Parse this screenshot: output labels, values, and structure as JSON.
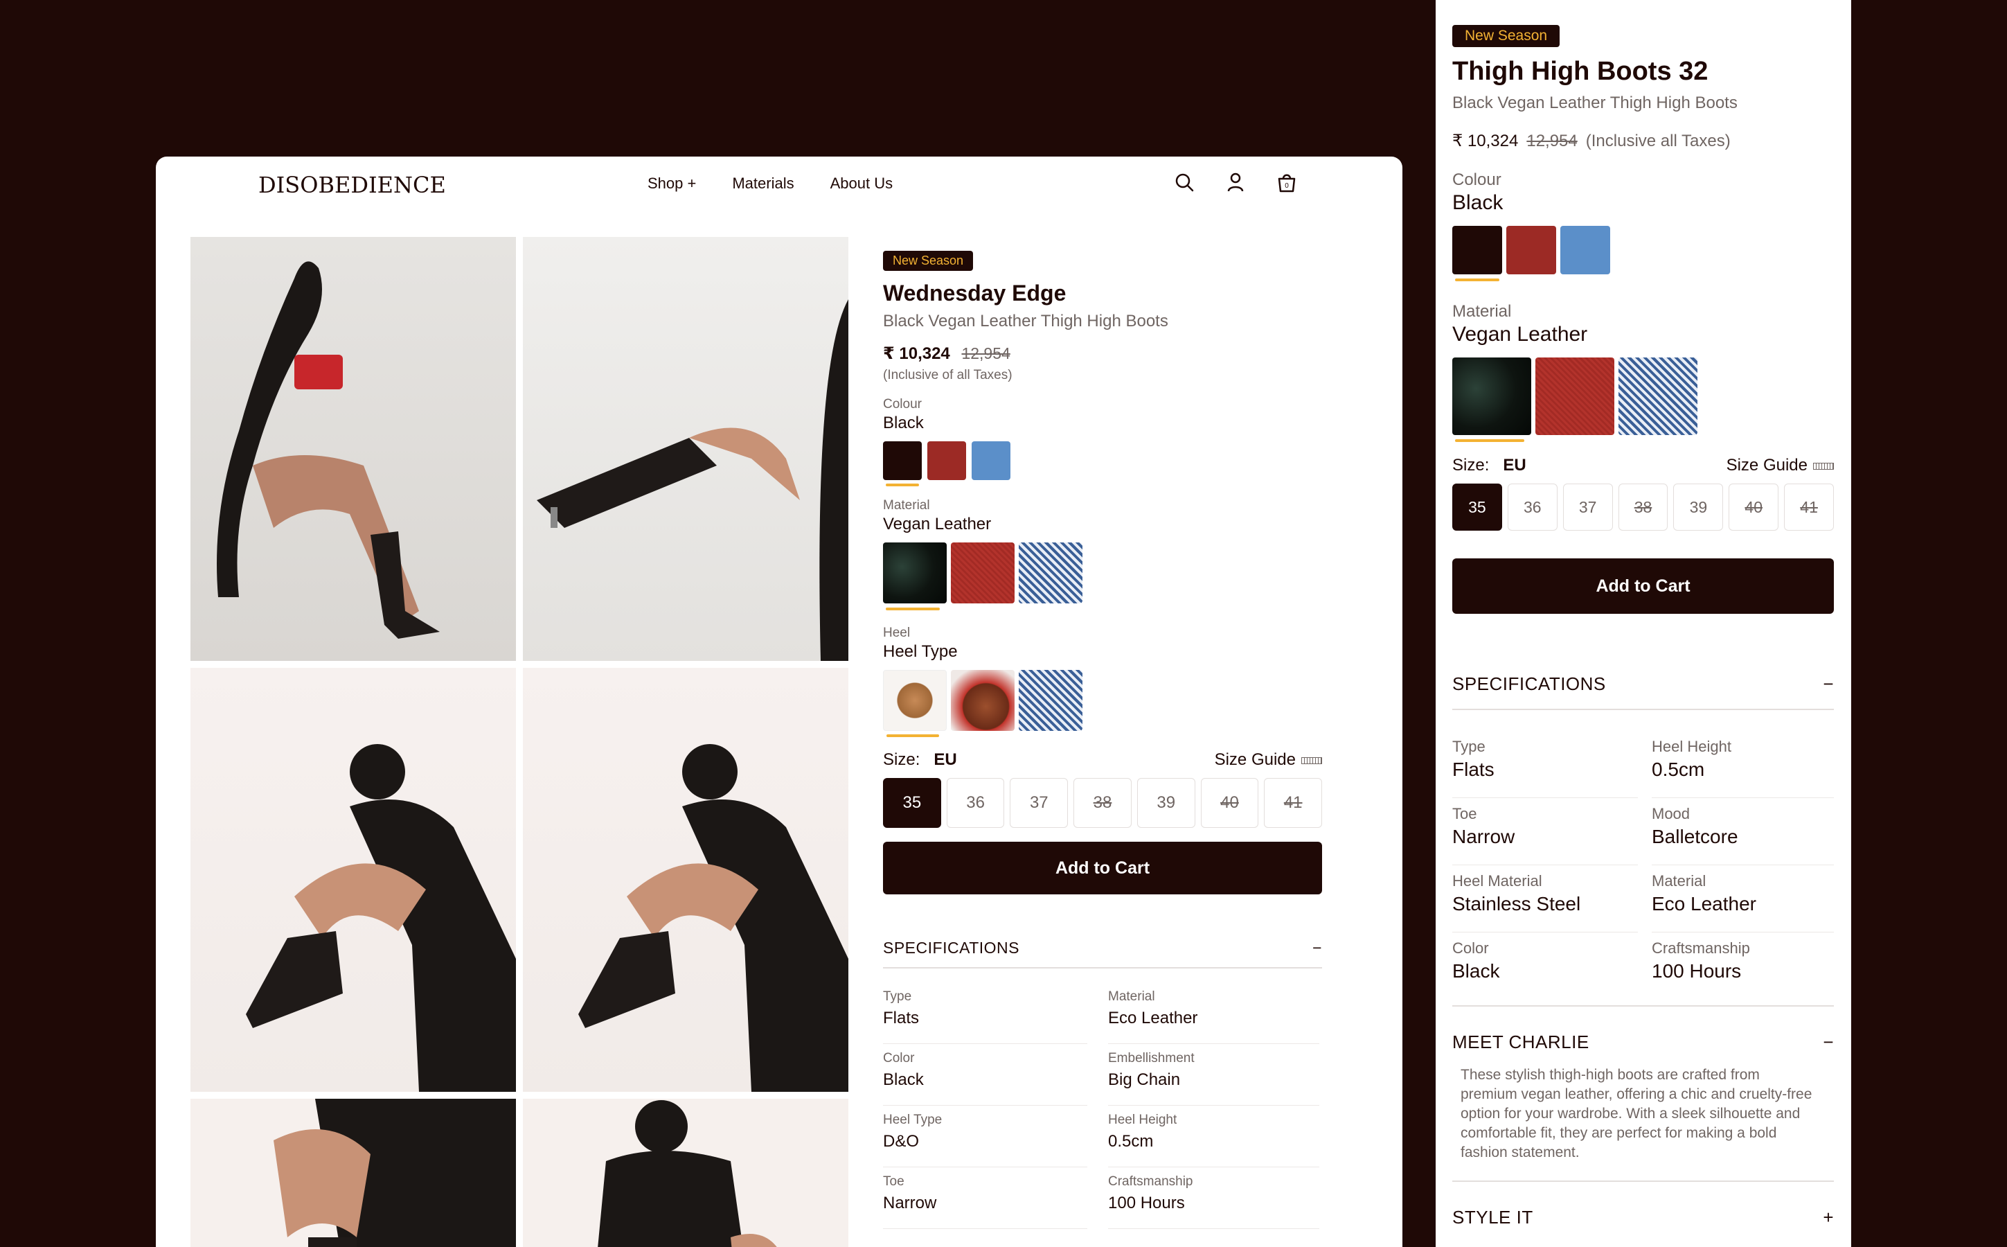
{
  "desktop": {
    "logo": "DISOBEDIENCE",
    "nav": [
      "Shop +",
      "Materials",
      "About Us"
    ],
    "icons": [
      "search-icon",
      "user-icon",
      "cart-icon"
    ],
    "cart_count": "0",
    "product": {
      "badge": "New Season",
      "title": "Wednesday Edge",
      "subtitle": "Black Vegan Leather Thigh High Boots",
      "price": "₹ 10,324",
      "old_price": "12,954",
      "tax": "(Inclusive of all Taxes)",
      "colour_label": "Colour",
      "colour_value": "Black",
      "colours": [
        "#1f0906",
        "#9c2a25",
        "#5b8fc9"
      ],
      "material_label": "Material",
      "material_value": "Vegan  Leather",
      "heel_label": "Heel",
      "heel_value": "Heel Type",
      "size_label": "Size:",
      "size_system": "EU",
      "size_guide": "Size Guide",
      "sizes": [
        "35",
        "36",
        "37",
        "38",
        "39",
        "40",
        "41"
      ],
      "add_to_cart": "Add to Cart",
      "spec_title": "SPECIFICATIONS",
      "spec_toggle": "−",
      "specs": [
        {
          "label": "Type",
          "value": "Flats"
        },
        {
          "label": "Material",
          "value": "Eco Leather"
        },
        {
          "label": "Color",
          "value": "Black"
        },
        {
          "label": "Embellishment",
          "value": "Big Chain"
        },
        {
          "label": "Heel Type",
          "value": "D&O"
        },
        {
          "label": "Heel Height",
          "value": "0.5cm"
        },
        {
          "label": "Toe",
          "value": "Narrow"
        },
        {
          "label": "Craftsmanship",
          "value": "100 Hours"
        }
      ]
    }
  },
  "mobile": {
    "badge": "New Season",
    "title": "Thigh High Boots 32",
    "subtitle": "Black Vegan Leather Thigh High Boots",
    "price": "₹ 10,324",
    "old_price": "12,954",
    "tax": "(Inclusive all Taxes)",
    "colour_label": "Colour",
    "colour_value": "Black",
    "material_label": "Material",
    "material_value": "Vegan  Leather",
    "size_label": "Size:",
    "size_system": "EU",
    "size_guide": "Size Guide",
    "sizes": [
      "35",
      "36",
      "37",
      "38",
      "39",
      "40",
      "41"
    ],
    "add_to_cart": "Add to Cart",
    "spec_title": "SPECIFICATIONS",
    "spec_toggle": "−",
    "specs": [
      {
        "label": "Type",
        "value": "Flats"
      },
      {
        "label": "Heel Height",
        "value": "0.5cm"
      },
      {
        "label": "Toe",
        "value": "Narrow"
      },
      {
        "label": "Mood",
        "value": "Balletcore"
      },
      {
        "label": "Heel Material",
        "value": "Stainless Steel"
      },
      {
        "label": "Material",
        "value": "Eco Leather"
      },
      {
        "label": "Color",
        "value": "Black"
      },
      {
        "label": "Craftsmanship",
        "value": "100 Hours"
      }
    ],
    "meet_title": "MEET CHARLIE",
    "meet_toggle": "−",
    "meet_text": "These stylish thigh-high boots are crafted from premium vegan leather, offering a chic and cruelty-free option for your wardrobe. With a sleek silhouette and comfortable fit, they are perfect for making a bold fashion statement.",
    "style_title": "STYLE IT",
    "style_toggle": "+"
  }
}
